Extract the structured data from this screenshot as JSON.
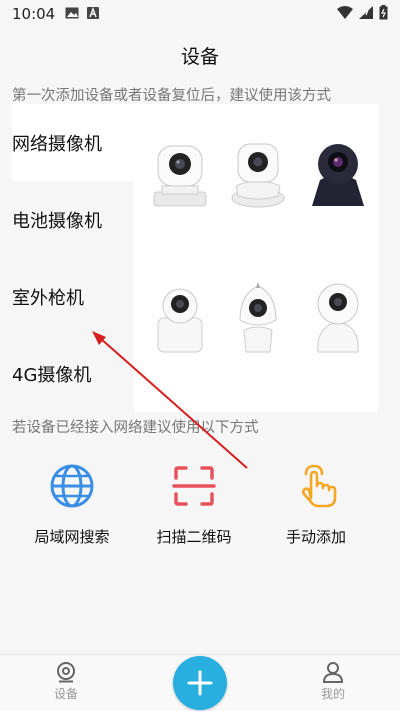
{
  "status_bar": {
    "time": "10:04"
  },
  "header": {
    "title": "设备"
  },
  "hints": {
    "first_add": "第一次添加设备或者设备复位后，建议使用该方式",
    "connected": "若设备已经接入网络建议使用以下方式"
  },
  "categories": [
    {
      "label": "网络摄像机",
      "selected": true
    },
    {
      "label": "电池摄像机",
      "selected": false
    },
    {
      "label": "室外枪机",
      "selected": false
    },
    {
      "label": "4G摄像机",
      "selected": false
    }
  ],
  "actions": [
    {
      "label": "局域网搜索",
      "icon": "globe-icon"
    },
    {
      "label": "扫描二维码",
      "icon": "scan-icon"
    },
    {
      "label": "手动添加",
      "icon": "hand-tap-icon"
    }
  ],
  "bottom_nav": {
    "device_label": "设备",
    "add_icon": "plus-icon",
    "me_label": "我的"
  },
  "colors": {
    "accent": "#29aee0",
    "globe": "#3a8ee6",
    "scan": "#e8505b",
    "hand": "#f5a623",
    "arrow": "#d62020"
  }
}
